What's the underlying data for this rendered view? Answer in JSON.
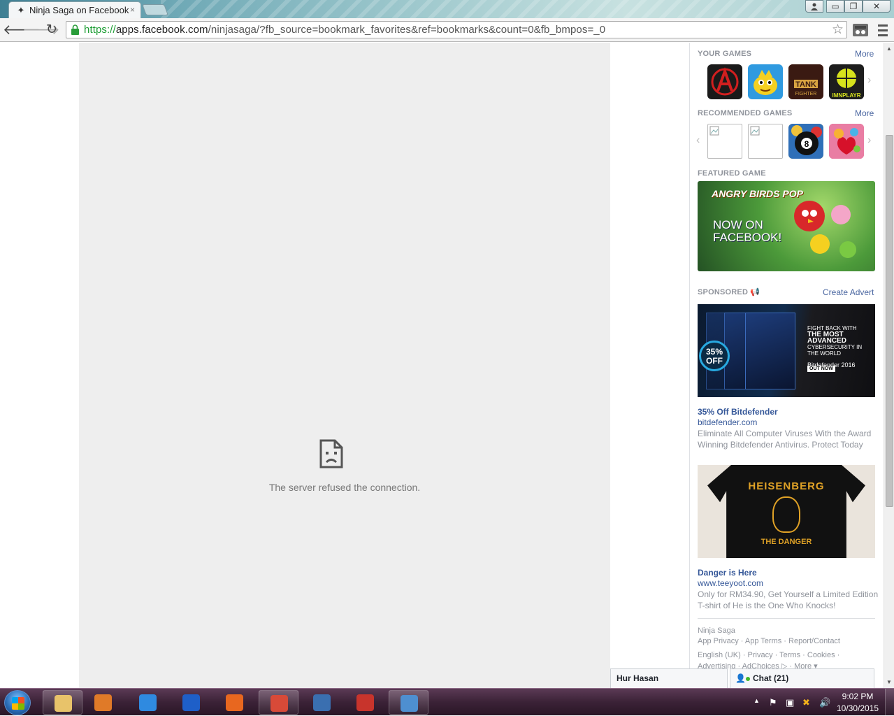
{
  "browser": {
    "tab_title": "Ninja Saga on Facebook",
    "tab_close": "×",
    "url_scheme": "https://",
    "url_host": "apps.facebook.com",
    "url_path": "/ninjasaga/?fb_source=bookmark_favorites&ref=bookmarks&count=0&fb_bmpos=_0",
    "window_buttons": {
      "minimize": "▭",
      "maximize": "❐",
      "close": "✕"
    }
  },
  "app_frame": {
    "error_message": "The server refused the connection."
  },
  "sidebar": {
    "your_games": {
      "heading": "YOUR GAMES",
      "more": "More",
      "games": [
        {
          "icon": "avengers-icon",
          "color": "#1a1a1a",
          "accent": "#d11f1f"
        },
        {
          "icon": "monster-game-icon",
          "color": "#2f9ae0",
          "accent": "#f5d020"
        },
        {
          "icon": "tank-fighter-icon",
          "color": "#7a2a1a",
          "accent": "#d9a441",
          "label": "TANK"
        },
        {
          "icon": "imnplayr-icon",
          "color": "#1d1d1d",
          "accent": "#d6e21c",
          "label": "IMNPLAYR"
        }
      ]
    },
    "recommended_games": {
      "heading": "RECOMMENDED GAMES",
      "more": "More",
      "games": [
        {
          "icon": "broken-image-icon"
        },
        {
          "icon": "broken-image-icon"
        },
        {
          "icon": "8-ball-pool-icon",
          "color": "#e8b531",
          "label": "8"
        },
        {
          "icon": "candy-crush-icon",
          "color": "#e73a6c",
          "accent": "#f7b233"
        }
      ]
    },
    "featured_game": {
      "heading": "FEATURED GAME",
      "title_art": "ANGRY BIRDS POP",
      "tagline": "NOW ON FACEBOOK!"
    },
    "sponsored": {
      "heading": "SPONSORED",
      "create_advert": "Create Advert",
      "ads": [
        {
          "title": "35% Off Bitdefender",
          "domain": "bitdefender.com",
          "description": "Eliminate All Computer Viruses With the Award Winning Bitdefender Antivirus. Protect Today",
          "art": {
            "badge": "35% OFF",
            "line1": "FIGHT BACK WITH",
            "line2": "THE MOST ADVANCED",
            "line3": "CYBERSECURITY IN THE WORLD",
            "brand": "Bitdefender 2016",
            "cta": "OUT NOW"
          }
        },
        {
          "title": "Danger is Here",
          "domain": "www.teeyoot.com",
          "description": "Only for RM34.90, Get Yourself a Limited Edition T-shirt of He is the One Who Knocks!",
          "art": {
            "headline": "HEISENBERG",
            "subline": "THE DANGER"
          }
        }
      ]
    },
    "footer": {
      "app_name": "Ninja Saga",
      "links_row1": "App Privacy · App Terms · Report/Contact",
      "links_row2": "English (UK) · Privacy · Terms · Cookies ·",
      "links_row3": "Advertising · AdChoices ▷ · More ▾"
    }
  },
  "chat": {
    "open_conversation": "Hur Hasan",
    "chat_label": "Chat (21)"
  },
  "taskbar": {
    "apps": [
      {
        "name": "windows-explorer-icon",
        "color": "#e8c36a"
      },
      {
        "name": "media-player-icon",
        "color": "#e07a28"
      },
      {
        "name": "internet-explorer-icon",
        "color": "#2f8ae0"
      },
      {
        "name": "maxthon-icon",
        "color": "#1e5fc8"
      },
      {
        "name": "firefox-icon",
        "color": "#e8671f"
      },
      {
        "name": "chrome-icon",
        "color": "#d84a38"
      },
      {
        "name": "settings-shield-icon",
        "color": "#3a6fb0"
      },
      {
        "name": "download-manager-icon",
        "color": "#c8342c"
      },
      {
        "name": "network-monitor-icon",
        "color": "#4e8fd0"
      }
    ],
    "clock_time": "9:02 PM",
    "clock_date": "10/30/2015"
  }
}
